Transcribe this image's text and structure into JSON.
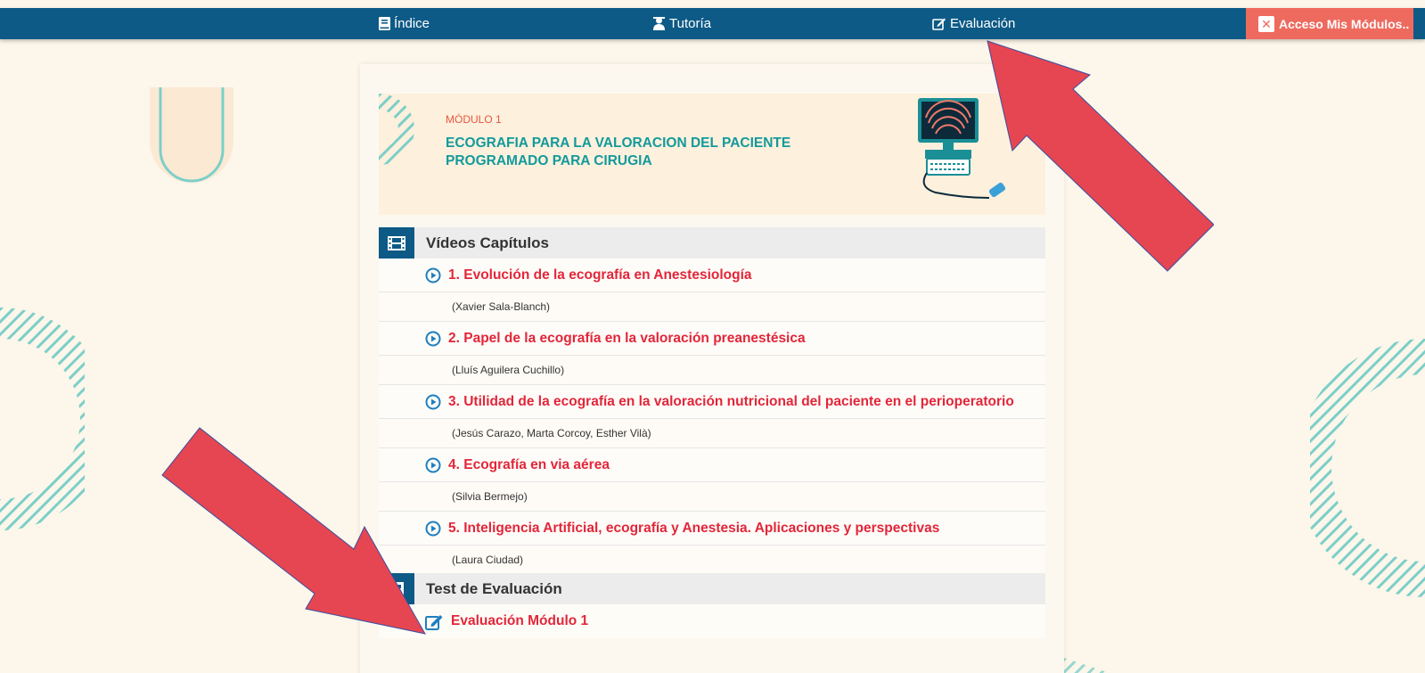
{
  "navbar": {
    "index_label": "Índice",
    "tutor_label": "Tutoría",
    "eval_label": "Evaluación",
    "access_label": "Acceso Mis Módulos..",
    "access_x": "✕"
  },
  "banner": {
    "module_label": "MÓDULO 1",
    "title": "ECOGRAFIA PARA LA VALORACION DEL PACIENTE PROGRAMADO PARA CIRUGIA"
  },
  "videos": {
    "header": "Vídeos Capítulos",
    "items": [
      {
        "title": "1. Evolución de la ecografía en Anestesiología",
        "author": "(Xavier Sala-Blanch)"
      },
      {
        "title": "2. Papel de la ecografía en la valoración preanestésica",
        "author": "(Lluís Aguilera Cuchillo)"
      },
      {
        "title": "3. Utilidad de la ecografía en la valoración nutricional del paciente en el perioperatorio",
        "author": "(Jesús Carazo, Marta Corcoy, Esther Vilà)"
      },
      {
        "title": "4. Ecografía en via aérea",
        "author": "(Silvia Bermejo)"
      },
      {
        "title": "5. Inteligencia Artificial, ecografía y Anestesia. Aplicaciones y perspectivas",
        "author": "(Laura Ciudad)"
      }
    ]
  },
  "test": {
    "header": "Test de Evaluación",
    "item": "Evaluación Módulo 1"
  },
  "colors": {
    "navbar": "#0d5a86",
    "accent_red": "#e2263a",
    "teal": "#139a9b",
    "access_button": "#ee6a5e",
    "arrow": "#e64552"
  }
}
